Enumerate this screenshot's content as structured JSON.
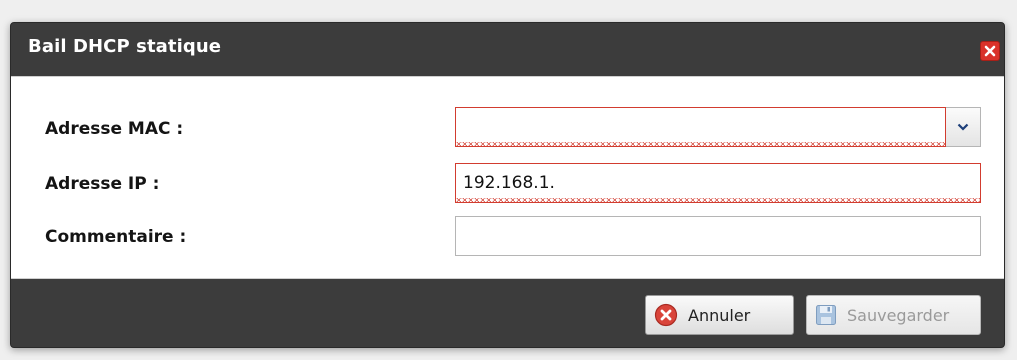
{
  "dialog": {
    "title": "Bail DHCP statique",
    "close_icon": "close-icon"
  },
  "form": {
    "mac_label": "Adresse MAC :",
    "mac_value": "",
    "mac_status": "invalid",
    "ip_label": "Adresse IP :",
    "ip_value": "192.168.1.",
    "ip_status": "invalid",
    "comment_label": "Commentaire :",
    "comment_value": ""
  },
  "footer": {
    "cancel_label": "Annuler",
    "cancel_icon": "cancel-icon",
    "save_label": "Sauvegarder",
    "save_icon": "save-icon",
    "save_enabled": false
  },
  "colors": {
    "dialog_frame": "#3c3c3c",
    "invalid_border": "#d23c2f",
    "close_button": "#d9322a"
  }
}
